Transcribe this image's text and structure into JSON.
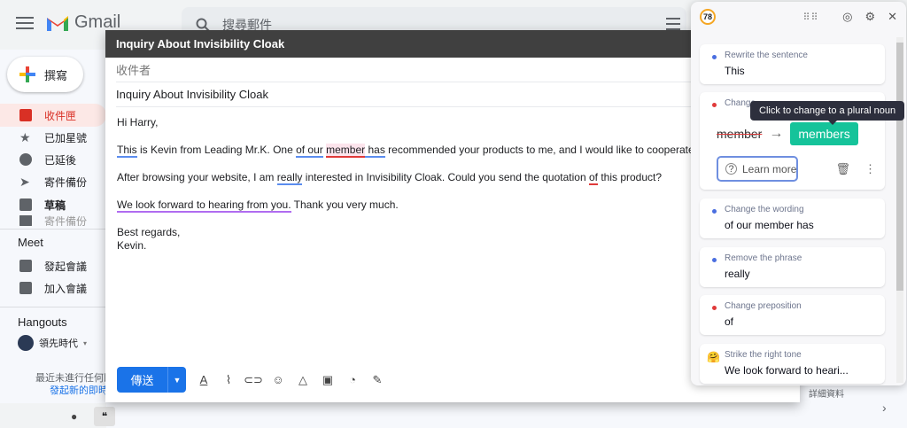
{
  "gmail": {
    "logo_text": "Gmail",
    "search_placeholder": "搜尋郵件",
    "compose_label": "撰寫",
    "nav": [
      "收件匣",
      "已加星號",
      "已延後",
      "寄件備份",
      "草稿",
      "寄件備份"
    ],
    "meet_title": "Meet",
    "meet_items": [
      "發起會議",
      "加入會議"
    ],
    "hangouts_title": "Hangouts",
    "hangouts_user": "領先時代",
    "hangouts_note": "最近未進行任何即時通訊",
    "hangouts_link": "發起新的即時通訊",
    "details_label": "詳細資料"
  },
  "compose": {
    "window_title": "Inquiry About Invisibility Cloak",
    "to_label": "收件者",
    "subject": "Inquiry About Invisibility Cloak",
    "greeting": "Hi Harry,",
    "p1_a": "This",
    "p1_b": " is Kevin from Leading Mr.K. One ",
    "p1_c": "of our",
    "p1_d": " ",
    "p1_e": "member",
    "p1_f": " has",
    "p1_g": " recommended your products to me, and I would like to cooperate with you.",
    "p2_a": "After browsing your website, I am ",
    "p2_b": "really",
    "p2_c": " interested in Invisibility Cloak. Could you send the quotation ",
    "p2_d": "of",
    "p2_e": " this product?",
    "p3_a": "We look forward to hearing from you.",
    "p3_b": " Thank you very much.",
    "closing": "Best regards,",
    "signature": "Kevin.",
    "send_label": "傳送"
  },
  "grammarly": {
    "score": "78",
    "tooltip": "Click to change to a plural noun",
    "cards": [
      {
        "title": "Rewrite the sentence",
        "value": "This",
        "dot": "#4a6ee0"
      },
      {
        "title": "Change",
        "value": "",
        "dot": "#e03a3a"
      },
      {
        "title": "Change the wording",
        "value": "of our member has",
        "dot": "#4a6ee0"
      },
      {
        "title": "Remove the phrase",
        "value": "really",
        "dot": "#4a6ee0"
      },
      {
        "title": "Change preposition",
        "value": "of",
        "dot": "#e03a3a"
      },
      {
        "title": "Strike the right tone",
        "value": "We look forward to heari...",
        "dot": "emoji"
      }
    ],
    "old_word": "member",
    "new_word": "members",
    "learn_more": "Learn more"
  },
  "colors": {
    "accent": "#1a73e8",
    "grammarly_green": "#15c39a",
    "error_red": "#e03a3a"
  }
}
